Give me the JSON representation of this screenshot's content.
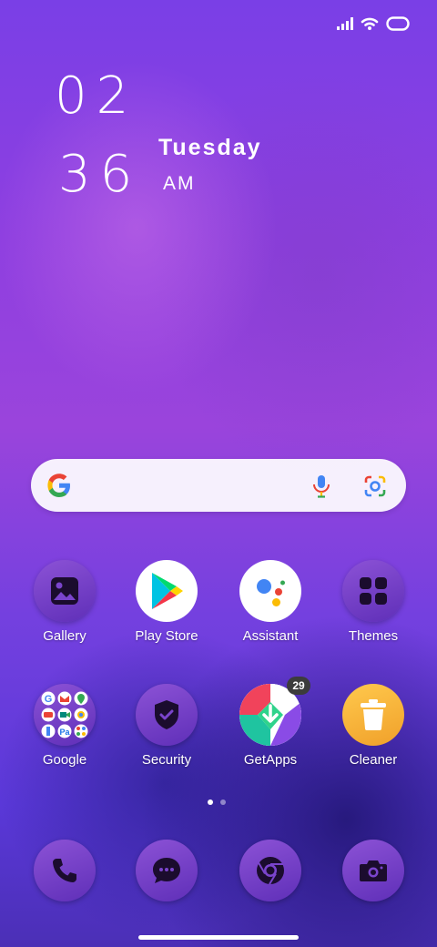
{
  "status_bar": {
    "icons": [
      "signal-icon",
      "wifi-icon",
      "battery-icon"
    ]
  },
  "clock": {
    "hour": "02",
    "minute": "36",
    "day": "Tuesday",
    "ampm": "AM"
  },
  "search": {
    "icons": [
      "google-logo-icon",
      "microphone-icon",
      "google-lens-icon"
    ]
  },
  "apps_row1": [
    {
      "label": "Gallery",
      "icon": "gallery-icon"
    },
    {
      "label": "Play Store",
      "icon": "play-store-icon"
    },
    {
      "label": "Assistant",
      "icon": "assistant-icon"
    },
    {
      "label": "Themes",
      "icon": "themes-icon"
    }
  ],
  "apps_row2": [
    {
      "label": "Google",
      "icon": "google-folder-icon"
    },
    {
      "label": "Security",
      "icon": "security-shield-icon"
    },
    {
      "label": "GetApps",
      "icon": "getapps-icon",
      "badge": "29"
    },
    {
      "label": "Cleaner",
      "icon": "trash-cleaner-icon"
    }
  ],
  "page_indicator": {
    "pages": 2,
    "current": 1
  },
  "dock": [
    {
      "icon": "phone-icon"
    },
    {
      "icon": "messages-icon"
    },
    {
      "icon": "chrome-icon"
    },
    {
      "icon": "camera-icon"
    }
  ],
  "colors": {
    "accent_purple": "#7b3fd8",
    "icon_bg": "#7a44cc",
    "cleaner_yellow": "#f6b63a"
  }
}
